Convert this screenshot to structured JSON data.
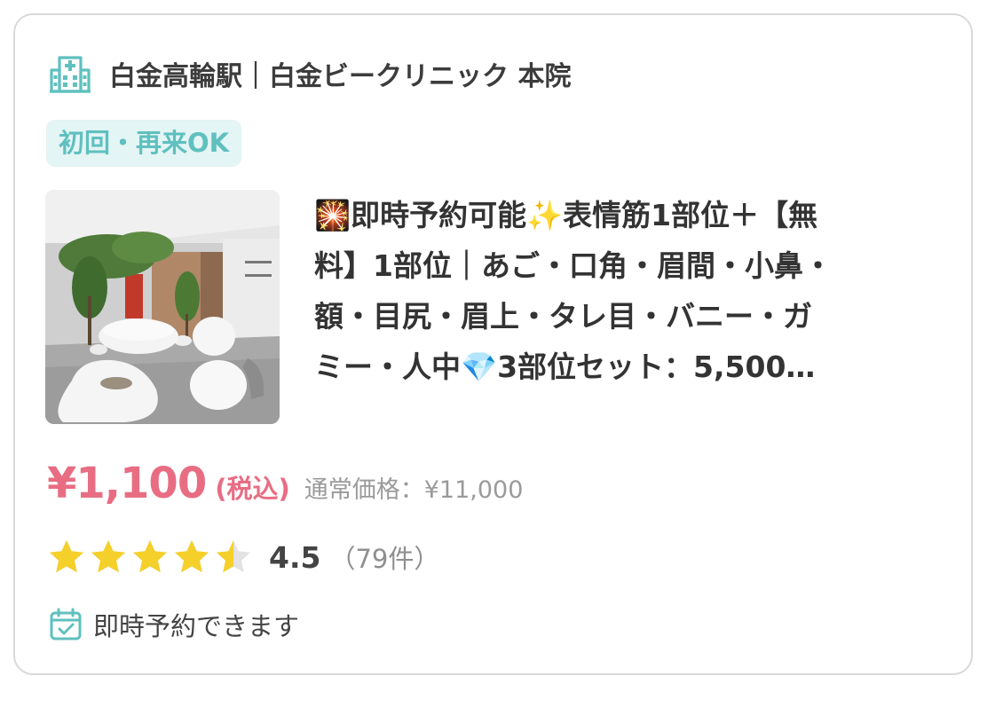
{
  "clinic": {
    "icon": "hospital-icon",
    "name": "白金高輪駅｜白金ビークリニック 本院"
  },
  "badge": {
    "label": "初回・再来OK"
  },
  "thumbnail": {
    "alt": "clinic-lobby-photo"
  },
  "title": {
    "line1": "🎇即時予約可能✨表情筋1部位＋【無",
    "line2": "料】1部位｜あご・口角・眉間・小鼻・",
    "line3": "額・目尻・眉上・タレ目・バニー・ガ",
    "line4": "ミー・人中💎3部位セット：5,500…"
  },
  "price": {
    "amount": "¥1,100",
    "tax_label": "(税込)",
    "regular": "通常価格：¥11,000"
  },
  "rating": {
    "score": "4.5",
    "count": "（79件）",
    "stars_value": 4.5,
    "stars_max": 5
  },
  "booking": {
    "icon": "calendar-check-icon",
    "label": "即時予約できます"
  },
  "colors": {
    "accent_teal": "#5fc0bf",
    "badge_bg": "#e3f5f4",
    "price_pink": "#e86d83",
    "star_yellow": "#f5cf2a"
  }
}
